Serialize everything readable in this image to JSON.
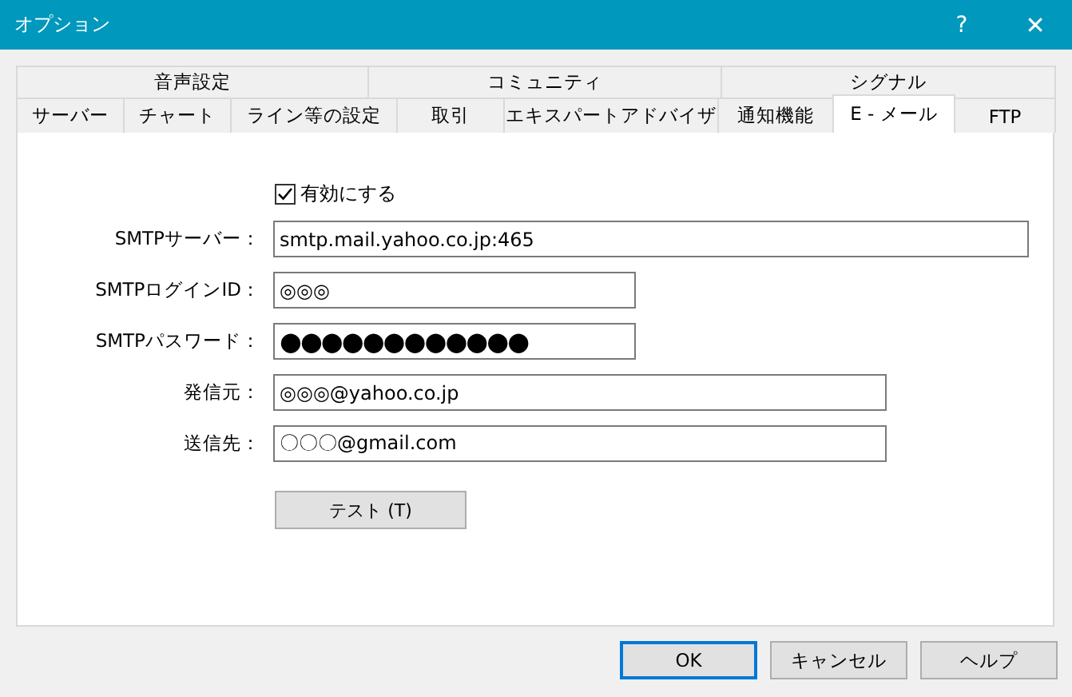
{
  "window": {
    "title": "オプション",
    "buttons": [
      "?",
      "✕"
    ]
  },
  "tab_rows": [
    [
      {
        "label": "音声設定",
        "selected": false
      },
      {
        "label": "コミュニティ",
        "selected": false
      },
      {
        "label": "シグナル",
        "selected": false
      }
    ],
    [
      {
        "label": "サーバー",
        "selected": false
      },
      {
        "label": "チャート",
        "selected": false
      },
      {
        "label": "ライン等の設定",
        "selected": false
      },
      {
        "label": "取引",
        "selected": false
      },
      {
        "label": "エキスパートアドバイザ",
        "selected": false
      },
      {
        "label": "通知機能",
        "selected": false
      },
      {
        "label": "E - メール",
        "selected": true
      },
      {
        "label": "FTP",
        "selected": false
      }
    ]
  ],
  "enable": {
    "label": "有効にする",
    "checked": true
  },
  "fields": [
    {
      "label": "SMTPサーバー：",
      "value": "smtp.mail.yahoo.co.jp:465",
      "kind": "wide"
    },
    {
      "label": "SMTPログインID：",
      "value": "◎◎◎",
      "kind": "short"
    },
    {
      "label": "SMTPパスワード：",
      "value": "●●●●●●●●●●●●",
      "kind": "password"
    },
    {
      "label": "発信元：",
      "value": "◎◎◎@yahoo.co.jp",
      "kind": "medium"
    },
    {
      "label": "送信先：",
      "value": "〇〇〇@gmail.com",
      "kind": "medium"
    }
  ],
  "test_button": "テスト (T)",
  "buttons": [
    {
      "label": "OK",
      "selected": true
    },
    {
      "label": "キャンセル",
      "selected": false
    },
    {
      "label": "ヘルプ",
      "selected": false
    }
  ]
}
